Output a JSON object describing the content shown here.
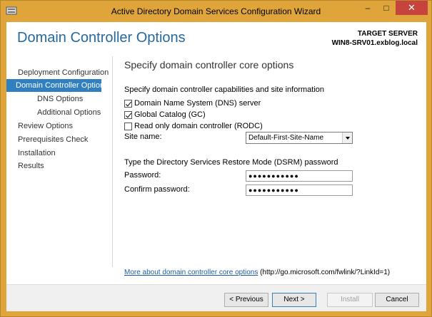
{
  "window": {
    "title": "Active Directory Domain Services Configuration Wizard",
    "minimize": "–",
    "maximize": "□",
    "close": "✕"
  },
  "header": {
    "page_title": "Domain Controller Options",
    "target_label": "TARGET SERVER",
    "target_name": "WIN8-SRV01.exblog.local"
  },
  "nav": {
    "items": [
      {
        "label": "Deployment Configuration"
      },
      {
        "label": "Domain Controller Options"
      },
      {
        "label": "DNS Options"
      },
      {
        "label": "Additional Options"
      },
      {
        "label": "Review Options"
      },
      {
        "label": "Prerequisites Check"
      },
      {
        "label": "Installation"
      },
      {
        "label": "Results"
      }
    ]
  },
  "main": {
    "section_title": "Specify domain controller core options",
    "capabilities_heading": "Specify domain controller capabilities and site information",
    "checkboxes": [
      {
        "label": "Domain Name System (DNS) server",
        "checked": true
      },
      {
        "label": "Global Catalog (GC)",
        "checked": true
      },
      {
        "label": "Read only domain controller (RODC)",
        "checked": false
      }
    ],
    "site_name_label": "Site name:",
    "site_name_value": "Default-First-Site-Name",
    "dsrm_heading": "Type the Directory Services Restore Mode (DSRM) password",
    "password_label": "Password:",
    "password_value": "●●●●●●●●●●●",
    "confirm_label": "Confirm password:",
    "confirm_value": "●●●●●●●●●●●",
    "more_link": "More about domain controller core options",
    "more_url": " (http://go.microsoft.com/fwlink/?LinkId=1)"
  },
  "footer": {
    "previous": "< Previous",
    "next": "Next >",
    "install": "Install",
    "cancel": "Cancel"
  },
  "colors": {
    "title_bar": "#e0a53a",
    "accent": "#2f7fc1",
    "page_title": "#26699f",
    "close_button": "#c7433d"
  }
}
